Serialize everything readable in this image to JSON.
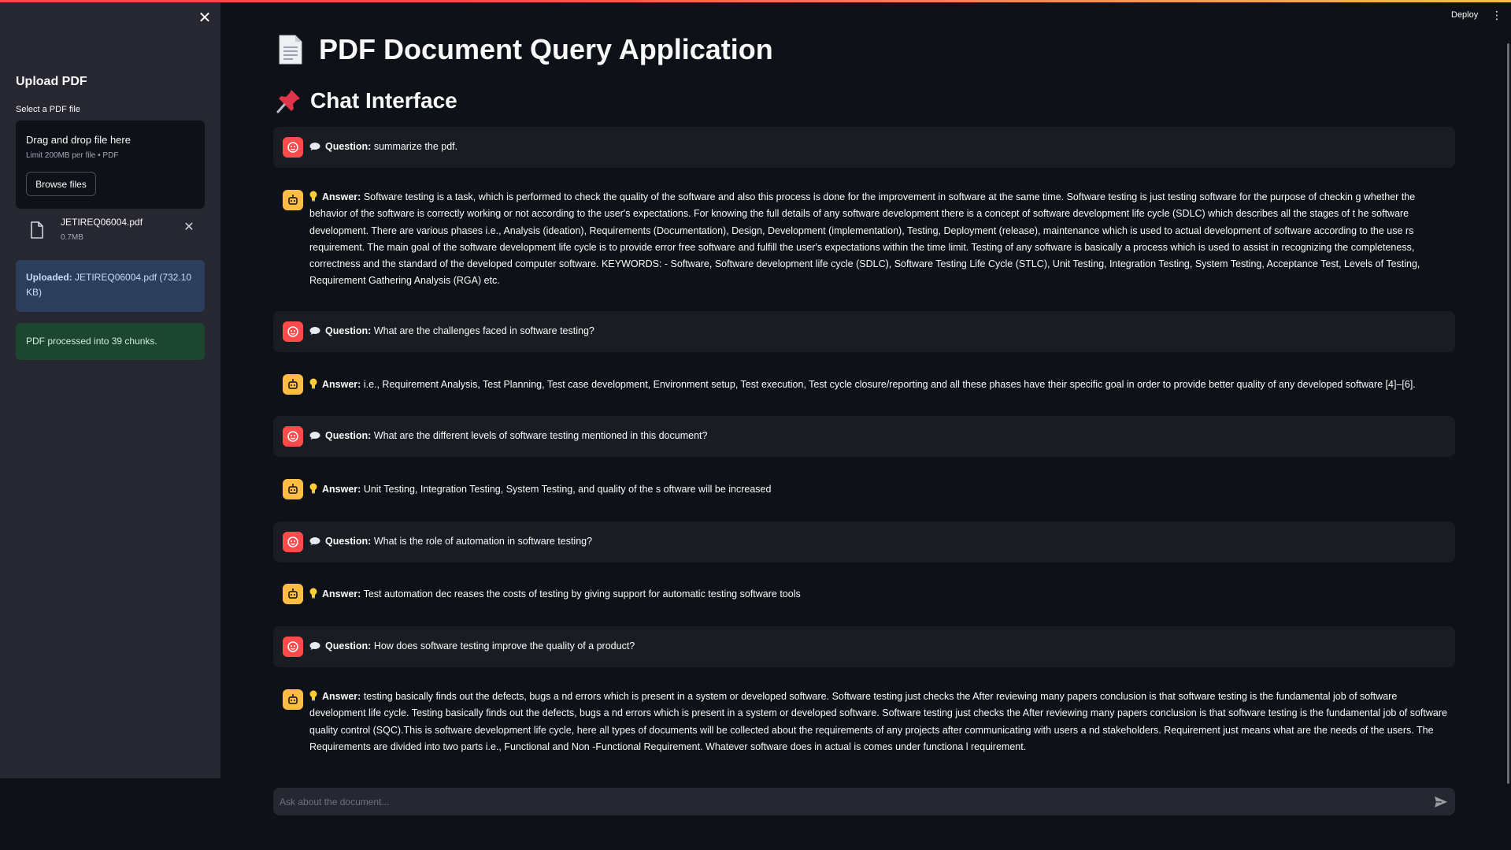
{
  "header": {
    "deploy_label": "Deploy",
    "menu_icon": "vertical-dots-icon"
  },
  "sidebar": {
    "close_icon": "close-icon",
    "title": "Upload PDF",
    "select_label": "Select a PDF file",
    "dropzone": {
      "title": "Drag and drop file here",
      "limit": "Limit 200MB per file • PDF",
      "browse_label": "Browse files"
    },
    "file": {
      "name": "JETIREQ06004.pdf",
      "size": "0.7MB"
    },
    "info": {
      "prefix": "Uploaded:",
      "text": "JETIREQ06004.pdf (732.10 KB)"
    },
    "success": "PDF processed into 39 chunks."
  },
  "main": {
    "title": "PDF Document Query Application",
    "chat_heading": "Chat Interface",
    "question_prefix": "Question:",
    "answer_prefix": "Answer:",
    "messages": [
      {
        "role": "question",
        "text": "summarize the pdf."
      },
      {
        "role": "answer",
        "text": "Software testing is a task, which is performed to check the quality of the software and also this process is done for the improvement in software at the same time. Software testing is just testing software for the purpose of checkin g whether the behavior of the software is correctly working or not according to the user's expectations. For knowing the full details of any software development there is a concept of software development life cycle (SDLC) which describes all the stages of t he software development. There are various phases i.e., Analysis (ideation), Requirements (Documentation), Design, Development (implementation), Testing, Deployment (release), maintenance which is used to actual development of software according to the use rs requirement. The main goal of the software development life cycle is to provide error free software and fulfill the user's expectations within the time limit. Testing of any software is basically a process which is used to assist in recognizing the completeness, correctness and the standard of the developed computer software. KEYWORDS: - Software, Software development life cycle (SDLC), Software Testing Life Cycle (STLC), Unit Testing, Integration Testing, System Testing, Acceptance Test, Levels of Testing, Requirement Gathering Analysis (RGA) etc."
      },
      {
        "role": "question",
        "text": "What are the challenges faced in software testing?"
      },
      {
        "role": "answer",
        "text": "i.e., Requirement Analysis, Test Planning, Test case development, Environment setup, Test execution, Test cycle closure/reporting and all these phases have their specific goal in order to provide better quality of any developed software [4]–[6]."
      },
      {
        "role": "question",
        "text": "What are the different levels of software testing mentioned in this document?"
      },
      {
        "role": "answer",
        "text": "Unit Testing, Integration Testing, System Testing, and quality of the s oftware will be increased"
      },
      {
        "role": "question",
        "text": "What is the role of automation in software testing?"
      },
      {
        "role": "answer",
        "text": "Test automation dec reases the costs of testing by giving support for automatic testing software tools"
      },
      {
        "role": "question",
        "text": "How does software testing improve the quality of a product?"
      },
      {
        "role": "answer",
        "text": "testing basically finds out the defects, bugs a nd errors which is present in a system or developed software. Software testing just checks the After reviewing many papers conclusion is that software testing is the fundamental job of software development life cycle. Testing basically finds out the defects, bugs a nd errors which is present in a system or developed software. Software testing just checks the After reviewing many papers conclusion is that software testing is the fundamental job of software quality control (SQC).This is software development life cycle, here all types of documents will be collected about the requirements of any projects after communicating with users a nd stakeholders. Requirement just means what are the needs of the users. The Requirements are divided into two parts i.e., Functional and Non -Functional Requirement. Whatever software does in actual is comes under functiona l requirement."
      }
    ],
    "chat_input": {
      "placeholder": "Ask about the document..."
    }
  },
  "colors": {
    "background": "#0e1117",
    "sidebar": "#262730",
    "user_avatar": "#ff4b4b",
    "bot_avatar": "#ffbd45",
    "info": "#2b3f5c",
    "success": "#1d4631"
  }
}
